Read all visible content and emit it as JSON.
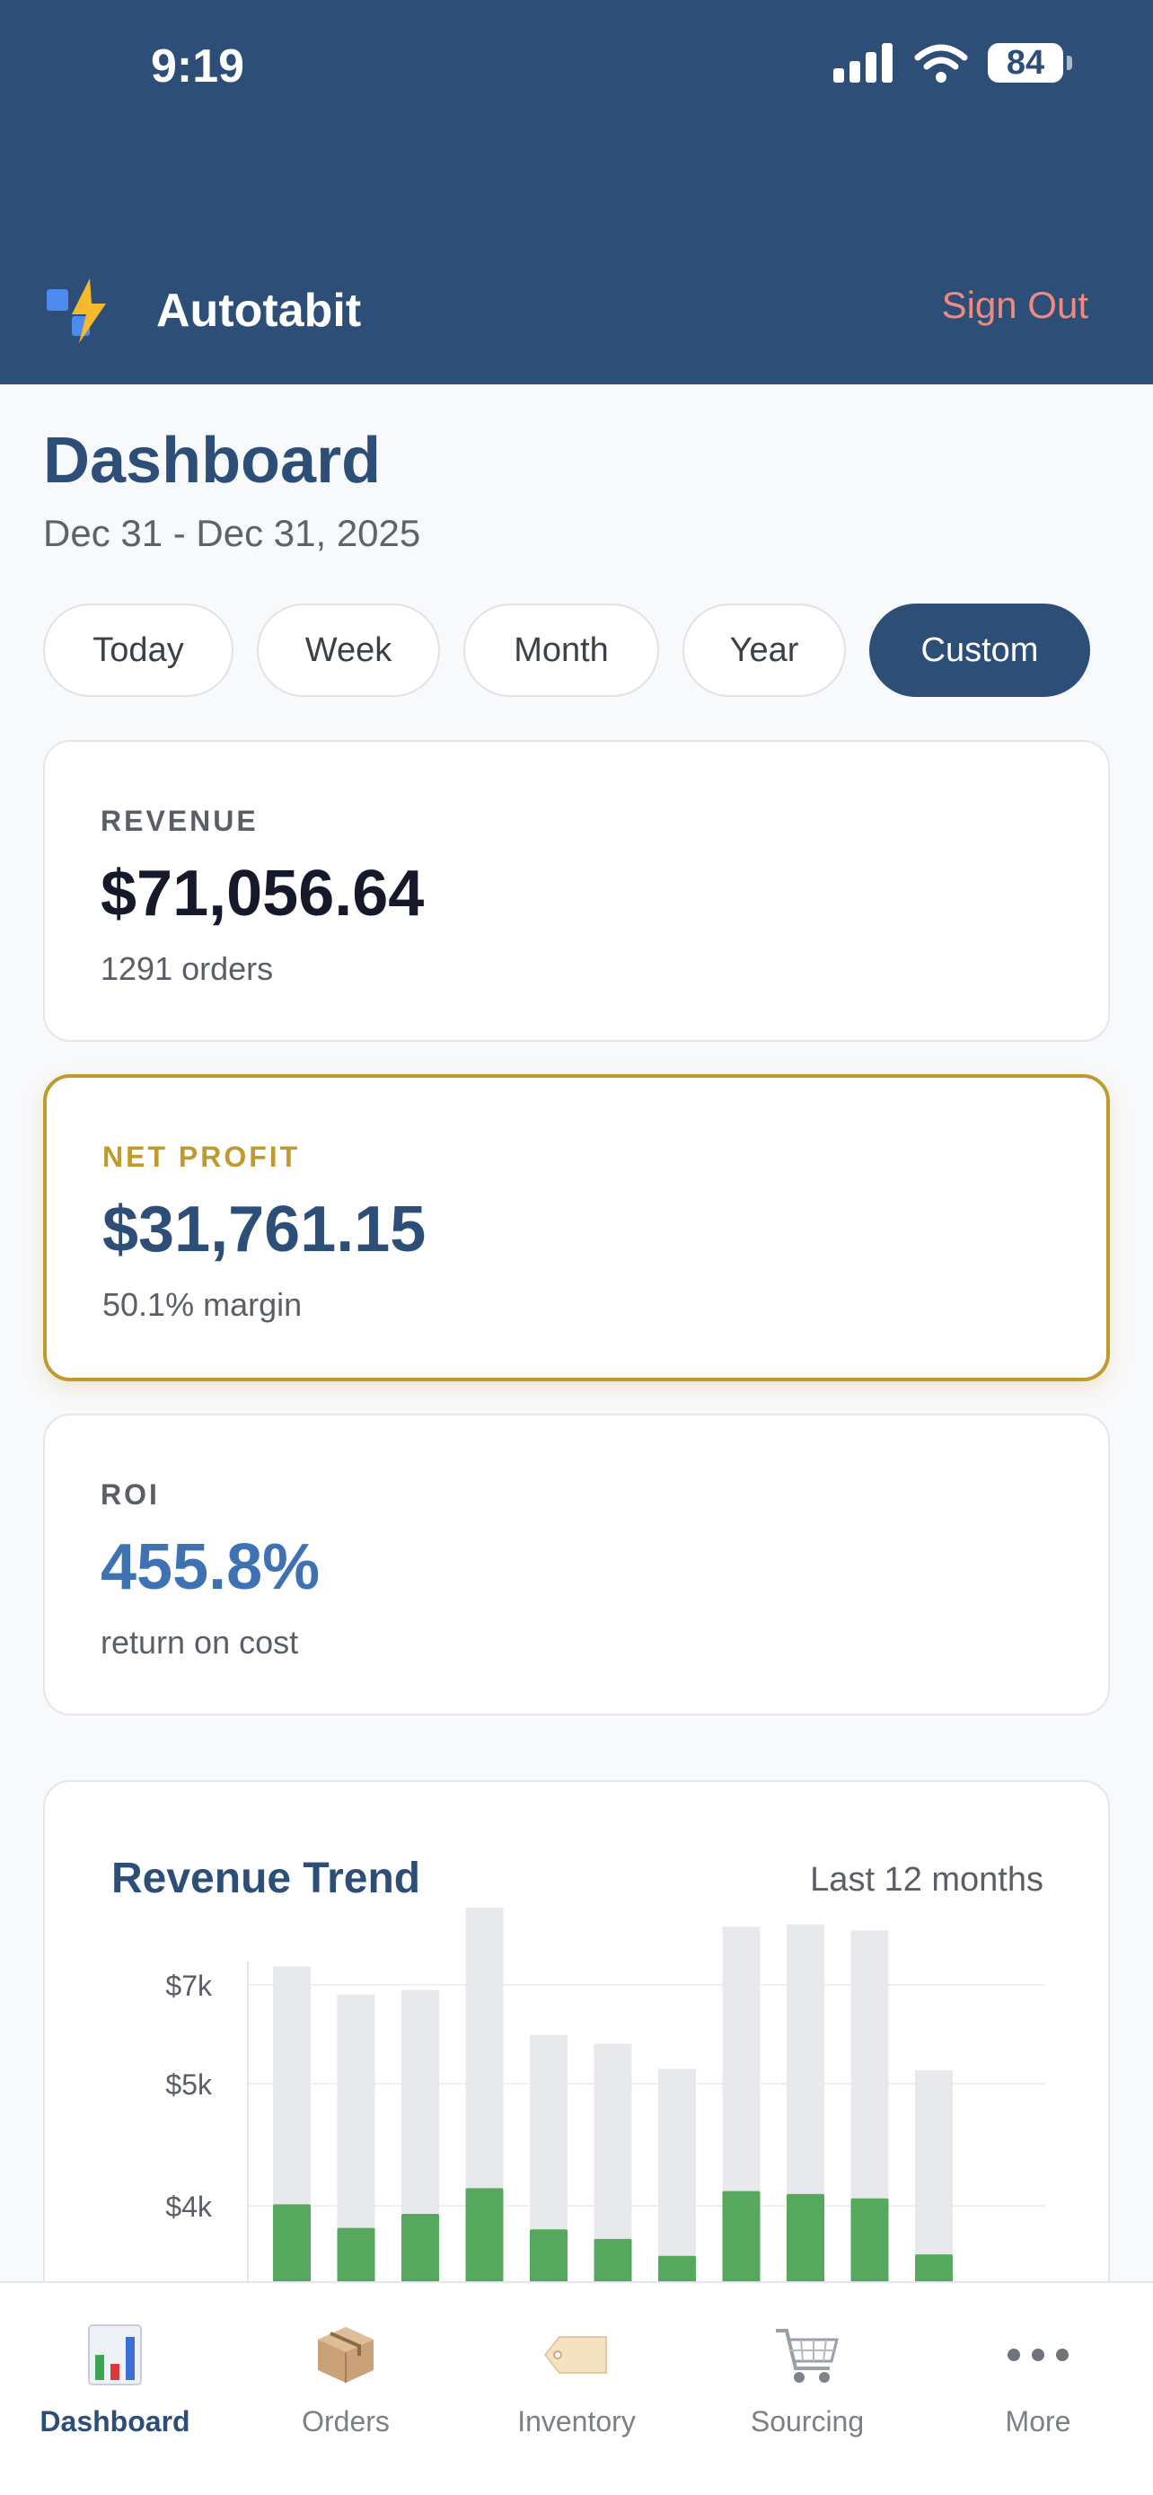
{
  "status": {
    "time": "9:19",
    "battery": "84"
  },
  "header": {
    "app_name": "Autotabit",
    "sign_out": "Sign Out"
  },
  "page": {
    "title": "Dashboard",
    "date_range": "Dec 31 - Dec 31, 2025"
  },
  "filters": [
    {
      "label": "Today",
      "active": false
    },
    {
      "label": "Week",
      "active": false
    },
    {
      "label": "Month",
      "active": false
    },
    {
      "label": "Year",
      "active": false
    },
    {
      "label": "Custom",
      "active": true
    }
  ],
  "cards": {
    "revenue": {
      "label": "REVENUE",
      "value": "$71,056.64",
      "sub": "1291 orders"
    },
    "profit": {
      "label": "NET PROFIT",
      "value": "$31,761.15",
      "sub": "50.1% margin"
    },
    "roi": {
      "label": "ROI",
      "value": "455.8%",
      "sub": "return on cost"
    }
  },
  "chart": {
    "title": "Revenue Trend",
    "range": "Last 12 months"
  },
  "chart_data": {
    "type": "bar",
    "title": "Revenue Trend",
    "ytick_labels": [
      "$7k",
      "$5k",
      "$4k"
    ],
    "series": [
      {
        "values": [
          7250,
          6870,
          6930,
          8050,
          6320,
          6200,
          5860,
          7790,
          7820,
          7740,
          5840,
          null
        ]
      },
      {
        "values": [
          4020,
          3700,
          3890,
          4240,
          3680,
          3550,
          3320,
          4200,
          4160,
          4100,
          3340,
          null
        ]
      }
    ],
    "colors": {
      "total": "#e8e9ec",
      "profit": "#55a85d"
    },
    "grid": true
  },
  "nav": [
    {
      "label": "Dashboard",
      "icon": "bar-chart-icon",
      "active": true
    },
    {
      "label": "Orders",
      "icon": "package-icon",
      "active": false
    },
    {
      "label": "Inventory",
      "icon": "tag-icon",
      "active": false
    },
    {
      "label": "Sourcing",
      "icon": "cart-icon",
      "active": false
    },
    {
      "label": "More",
      "icon": "more-dots-icon",
      "active": false
    }
  ]
}
